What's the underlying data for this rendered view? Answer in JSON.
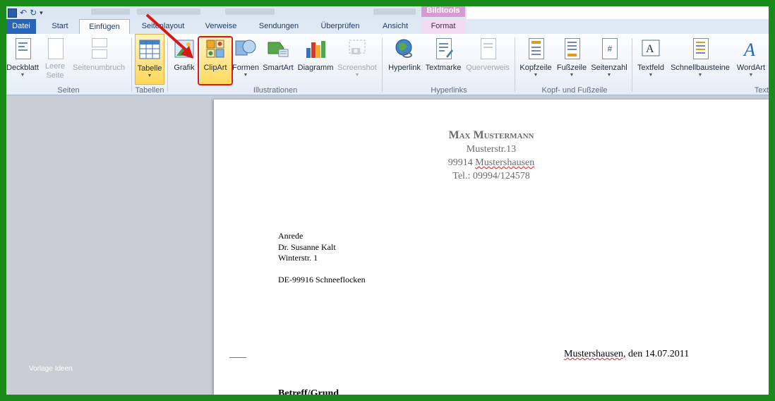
{
  "window": {
    "context_tab_header": "Bildtools"
  },
  "tabs": [
    "Datei",
    "Start",
    "Einfügen",
    "Seitenlayout",
    "Verweise",
    "Sendungen",
    "Überprüfen",
    "Ansicht",
    "Format"
  ],
  "ribbon": {
    "seiten": {
      "group": "Seiten",
      "deckblatt": "Deckblatt",
      "leere_seite_1": "Leere",
      "leere_seite_2": "Seite",
      "seitenumbruch": "Seitenumbruch"
    },
    "tabellen": {
      "group": "Tabellen",
      "tabelle": "Tabelle"
    },
    "illustrationen": {
      "group": "Illustrationen",
      "grafik": "Grafik",
      "clipart": "ClipArt",
      "formen": "Formen",
      "smartart": "SmartArt",
      "diagramm": "Diagramm",
      "screenshot": "Screenshot"
    },
    "hyperlinks": {
      "group": "Hyperlinks",
      "hyperlink": "Hyperlink",
      "textmarke": "Textmarke",
      "querverweis": "Querverweis"
    },
    "kopf_fuss": {
      "group": "Kopf- und Fußzeile",
      "kopfzeile": "Kopfzeile",
      "fusszeile": "Fußzeile",
      "seitenzahl": "Seitenzahl"
    },
    "text": {
      "group": "Text",
      "textfeld": "Textfeld",
      "schnellbausteine": "Schnellbausteine",
      "wordart": "WordArt"
    }
  },
  "sidebar": {
    "label": "Vorlage Ideen"
  },
  "document": {
    "sender_name": "Max Mustermann",
    "sender_street": "Musterstr.13",
    "sender_city_zip": "99914",
    "sender_city": "Mustershausen",
    "sender_phone": "Tel.: 09994/124578",
    "recipient_lines": [
      "Anrede",
      "Dr. Susanne Kalt",
      "Winterstr. 1"
    ],
    "recipient_city": "DE-99916 Schneeflocken",
    "date_place": "Mustershausen,",
    "date": " den 14.07.2011",
    "subject": "Betreff/Grund"
  },
  "colors": {
    "frame": "#1a8a1a",
    "accent_blue": "#2a64b8",
    "highlight": "#e01818",
    "context_tab": "#d79ad3"
  }
}
